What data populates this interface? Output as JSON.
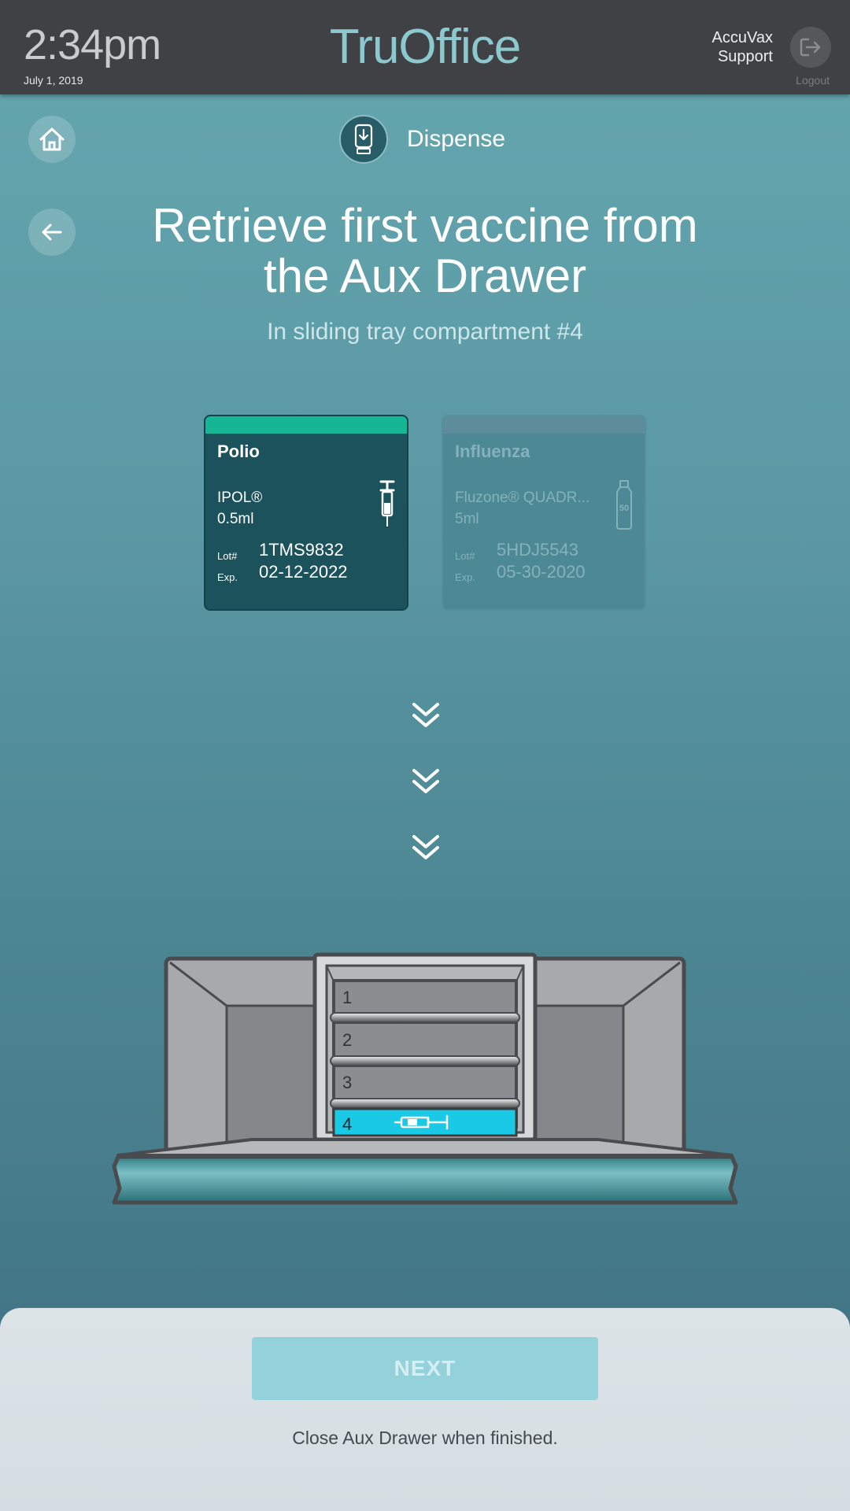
{
  "header": {
    "time": "2:34pm",
    "date": "July 1, 2019",
    "brand": "TruOffice",
    "support_line1": "AccuVax",
    "support_line2": "Support",
    "logout_label": "Logout"
  },
  "nav": {
    "section_label": "Dispense",
    "home_icon": "home-icon",
    "back_icon": "arrow-left-icon",
    "section_icon": "dispense-icon"
  },
  "instruction": {
    "title_line1": "Retrieve first vaccine from",
    "title_line2": "the Aux Drawer",
    "subtitle": "In sliding tray compartment #4"
  },
  "vaccines": [
    {
      "name": "Polio",
      "product": "IPOL®",
      "volume": "0.5ml",
      "lot_label": "Lot#",
      "lot": "1TMS9832",
      "exp_label": "Exp.",
      "exp": "02-12-2022",
      "icon": "syringe-icon",
      "active": true,
      "accent": "#16b695"
    },
    {
      "name": "Influenza",
      "product": "Fluzone® QUADR...",
      "volume": "5ml",
      "lot_label": "Lot#",
      "lot": "5HDJ5543",
      "exp_label": "Exp.",
      "exp": "05-30-2020",
      "icon": "vial-icon",
      "icon_text": "50",
      "active": false
    }
  ],
  "drawer": {
    "compartments": [
      "1",
      "2",
      "3",
      "4"
    ],
    "highlighted_compartment": "4",
    "highlight_color": "#19c9e6"
  },
  "footer": {
    "next_label": "NEXT",
    "hint": "Close Aux Drawer when finished."
  }
}
